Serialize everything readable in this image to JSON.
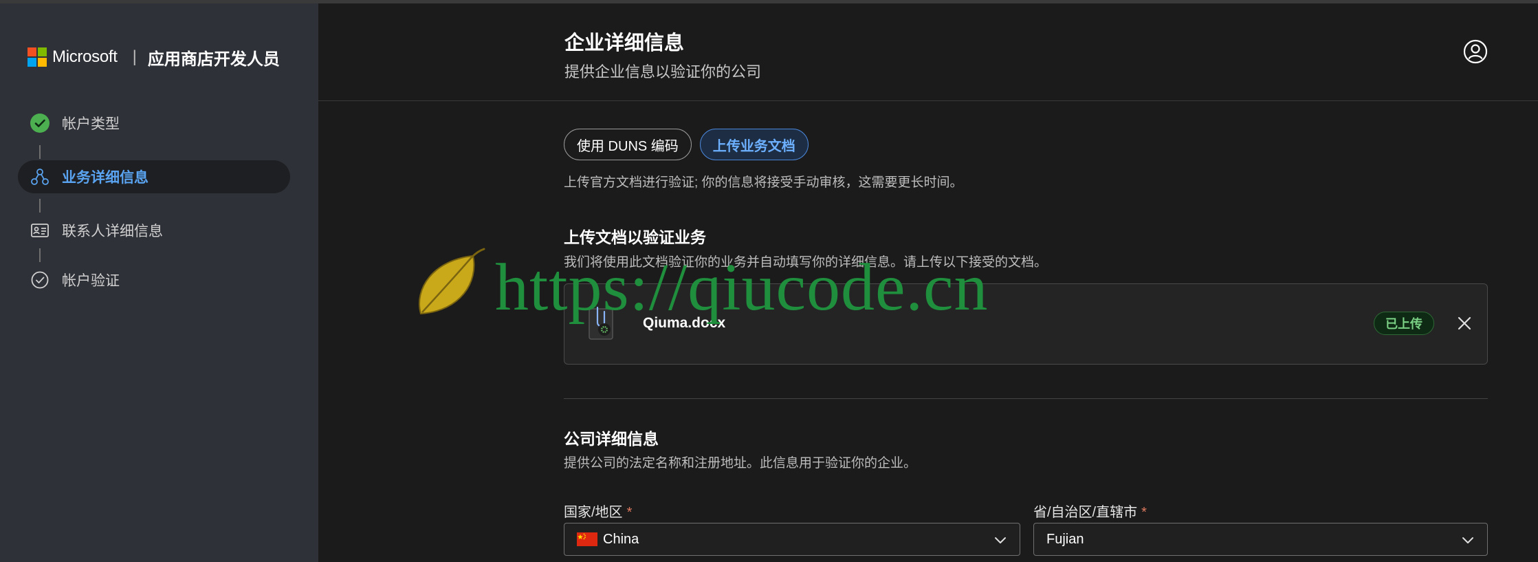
{
  "brand": {
    "company": "Microsoft",
    "separator": "|",
    "product": "应用商店开发人员",
    "logo_colors": [
      "#f25022",
      "#7fba00",
      "#00a4ef",
      "#ffb900"
    ]
  },
  "steps": [
    {
      "label": "帐户类型",
      "state": "done",
      "icon": "check-circle-icon"
    },
    {
      "label": "业务详细信息",
      "state": "active",
      "icon": "organization-icon"
    },
    {
      "label": "联系人详细信息",
      "state": "pending",
      "icon": "contact-card-icon"
    },
    {
      "label": "帐户验证",
      "state": "pending",
      "icon": "check-outline-icon"
    }
  ],
  "header": {
    "title": "企业详细信息",
    "subtitle": "提供企业信息以验证你的公司",
    "avatar_icon": "user-avatar-icon"
  },
  "verification_mode": {
    "options": [
      "使用 DUNS 编码",
      "上传业务文档"
    ],
    "selected": "上传业务文档",
    "hint": "上传官方文档进行验证; 你的信息将接受手动审核，这需要更长时间。"
  },
  "upload_section": {
    "title": "上传文档以验证业务",
    "description": "我们将使用此文档验证你的业务并自动填写你的详细信息。请上传以下接受的文档。",
    "file": {
      "name": "Qiuma.docx",
      "status": "已上传",
      "icon": "document-attachment-icon",
      "remove_icon": "close-icon"
    }
  },
  "company_section": {
    "title": "公司详细信息",
    "description": "提供公司的法定名称和注册地址。此信息用于验证你的企业。",
    "fields": {
      "country": {
        "label": "国家/地区",
        "required_mark": "*",
        "value": "China",
        "flag_icon": "china-flag-icon"
      },
      "province": {
        "label": "省/自治区/直辖市",
        "required_mark": "*",
        "value": "Fujian"
      }
    }
  },
  "watermark": {
    "text": "https://qiucode.cn",
    "icon": "leaf-icon"
  },
  "colors": {
    "sidebar_bg": "#2f3138",
    "main_bg": "#1b1b1b",
    "accent_blue": "#5aa3f0",
    "success_green": "#4caf50",
    "watermark_green": "#1f8f3d"
  }
}
